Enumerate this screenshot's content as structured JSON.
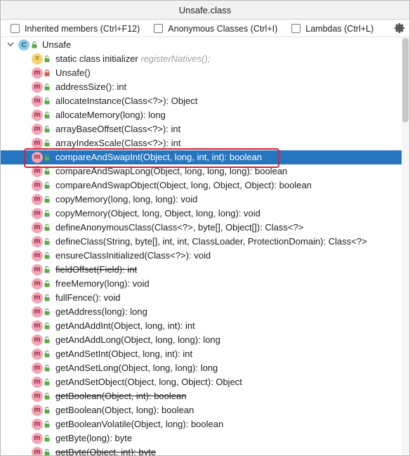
{
  "window": {
    "title": "Unsafe.class"
  },
  "filters": [
    {
      "label": "Inherited members (Ctrl+F12)",
      "checked": false
    },
    {
      "label": "Anonymous Classes (Ctrl+I)",
      "checked": false
    },
    {
      "label": "Lambdas (Ctrl+L)",
      "checked": false
    }
  ],
  "tree": {
    "root": {
      "name": "Unsafe",
      "icon": "class-icon",
      "expanded": true
    },
    "items": [
      {
        "text": "static class initializer",
        "hint": "registerNatives();",
        "icon": "initializer-icon",
        "access": "public",
        "strike": false,
        "selected": false
      },
      {
        "text": "Unsafe()",
        "icon": "method-icon",
        "access": "private",
        "strike": false,
        "selected": false
      },
      {
        "text": "addressSize(): int",
        "icon": "method-icon",
        "access": "public",
        "strike": false,
        "selected": false
      },
      {
        "text": "allocateInstance(Class<?>): Object",
        "icon": "method-icon",
        "access": "public",
        "strike": false,
        "selected": false
      },
      {
        "text": "allocateMemory(long): long",
        "icon": "method-icon",
        "access": "public",
        "strike": false,
        "selected": false
      },
      {
        "text": "arrayBaseOffset(Class<?>): int",
        "icon": "method-icon",
        "access": "public",
        "strike": false,
        "selected": false
      },
      {
        "text": "arrayIndexScale(Class<?>): int",
        "icon": "method-icon",
        "access": "public",
        "strike": false,
        "selected": false
      },
      {
        "text": "compareAndSwapInt(Object, long, int, int): boolean",
        "icon": "method-icon",
        "access": "public",
        "strike": false,
        "selected": true
      },
      {
        "text": "compareAndSwapLong(Object, long, long, long): boolean",
        "icon": "method-icon",
        "access": "public",
        "strike": false,
        "selected": false
      },
      {
        "text": "compareAndSwapObject(Object, long, Object, Object): boolean",
        "icon": "method-icon",
        "access": "public",
        "strike": false,
        "selected": false
      },
      {
        "text": "copyMemory(long, long, long): void",
        "icon": "method-icon",
        "access": "public",
        "strike": false,
        "selected": false
      },
      {
        "text": "copyMemory(Object, long, Object, long, long): void",
        "icon": "method-icon",
        "access": "public",
        "strike": false,
        "selected": false
      },
      {
        "text": "defineAnonymousClass(Class<?>, byte[], Object[]): Class<?>",
        "icon": "method-icon",
        "access": "public",
        "strike": false,
        "selected": false
      },
      {
        "text": "defineClass(String, byte[], int, int, ClassLoader, ProtectionDomain): Class<?>",
        "icon": "method-icon",
        "access": "public",
        "strike": false,
        "selected": false
      },
      {
        "text": "ensureClassInitialized(Class<?>): void",
        "icon": "method-icon",
        "access": "public",
        "strike": false,
        "selected": false
      },
      {
        "text": "fieldOffset(Field): int",
        "icon": "method-icon",
        "access": "public",
        "strike": true,
        "selected": false
      },
      {
        "text": "freeMemory(long): void",
        "icon": "method-icon",
        "access": "public",
        "strike": false,
        "selected": false
      },
      {
        "text": "fullFence(): void",
        "icon": "method-icon",
        "access": "public",
        "strike": false,
        "selected": false
      },
      {
        "text": "getAddress(long): long",
        "icon": "method-icon",
        "access": "public",
        "strike": false,
        "selected": false
      },
      {
        "text": "getAndAddInt(Object, long, int): int",
        "icon": "method-icon",
        "access": "public",
        "strike": false,
        "selected": false
      },
      {
        "text": "getAndAddLong(Object, long, long): long",
        "icon": "method-icon",
        "access": "public",
        "strike": false,
        "selected": false
      },
      {
        "text": "getAndSetInt(Object, long, int): int",
        "icon": "method-icon",
        "access": "public",
        "strike": false,
        "selected": false
      },
      {
        "text": "getAndSetLong(Object, long, long): long",
        "icon": "method-icon",
        "access": "public",
        "strike": false,
        "selected": false
      },
      {
        "text": "getAndSetObject(Object, long, Object): Object",
        "icon": "method-icon",
        "access": "public",
        "strike": false,
        "selected": false
      },
      {
        "text": "getBoolean(Object, int): boolean",
        "icon": "method-icon",
        "access": "public",
        "strike": true,
        "selected": false
      },
      {
        "text": "getBoolean(Object, long): boolean",
        "icon": "method-icon",
        "access": "public",
        "strike": false,
        "selected": false
      },
      {
        "text": "getBooleanVolatile(Object, long): boolean",
        "icon": "method-icon",
        "access": "public",
        "strike": false,
        "selected": false
      },
      {
        "text": "getByte(long): byte",
        "icon": "method-icon",
        "access": "public",
        "strike": false,
        "selected": false
      },
      {
        "text": "getByte(Object, int): byte",
        "icon": "method-icon",
        "access": "public",
        "strike": true,
        "selected": false
      }
    ]
  },
  "colors": {
    "selection": "#2675bf",
    "highlight_border": "#e0202a",
    "method_icon": "#f3a3b4",
    "class_icon": "#8ec9e8",
    "public_access": "#5aa94a",
    "private_access": "#d9534f"
  }
}
